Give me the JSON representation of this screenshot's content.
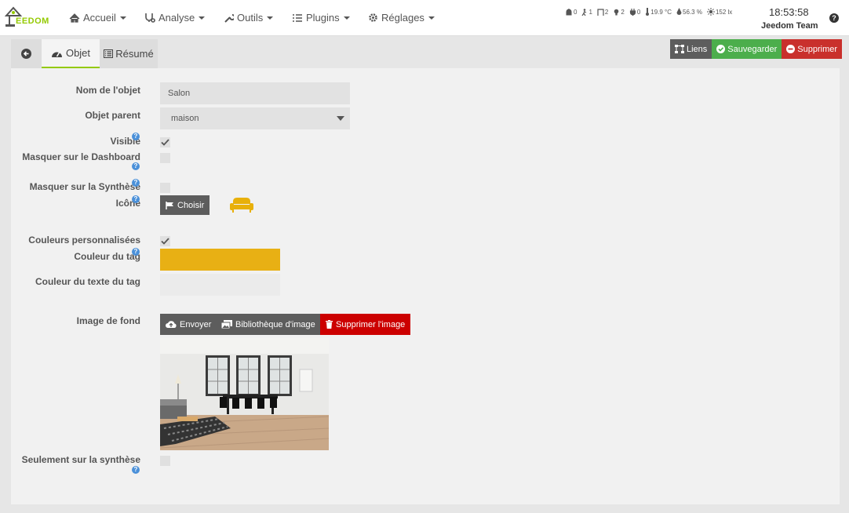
{
  "header": {
    "logo_text": "EEDOM",
    "menu": [
      {
        "label": "Accueil",
        "icon": "home-icon"
      },
      {
        "label": "Analyse",
        "icon": "stethoscope-icon"
      },
      {
        "label": "Outils",
        "icon": "wrench-icon"
      },
      {
        "label": "Plugins",
        "icon": "list-icon"
      },
      {
        "label": "Réglages",
        "icon": "gear-icon"
      }
    ],
    "status": {
      "alarm": "0",
      "motion": "1",
      "door": "2",
      "light": "2",
      "plug": "0",
      "temperature": "19.9 °C",
      "humidity": "56.3 %",
      "luminosity": "152 lx"
    },
    "time": "18:53:58",
    "user": "Jeedom Team",
    "help": "?"
  },
  "tabs": {
    "object": "Objet",
    "summary": "Résumé"
  },
  "actions": {
    "links": "Liens",
    "save": "Sauvegarder",
    "delete": "Supprimer"
  },
  "form": {
    "name_label": "Nom de l'objet",
    "name_value": "Salon",
    "parent_label": "Objet parent",
    "parent_value": "maison",
    "visible_label": "Visible",
    "visible_checked": true,
    "hide_dashboard_label": "Masquer sur le Dashboard",
    "hide_dashboard_checked": false,
    "hide_synthesis_label": "Masquer sur la Synthèse",
    "hide_synthesis_checked": false,
    "icon_label": "Icône",
    "choose_label": "Choisir",
    "icon_preview": "sofa-icon",
    "icon_color": "#e8b00a",
    "custom_colors_label": "Couleurs personnalisées",
    "custom_colors_checked": true,
    "tag_color_label": "Couleur du tag",
    "tag_color": "#e8b014",
    "tag_text_color_label": "Couleur du texte du tag",
    "tag_text_color": "#ebebeb",
    "background_label": "Image de fond",
    "upload_label": "Envoyer",
    "library_label": "Bibliothèque d'image",
    "remove_image_label": "Supprimer l'image",
    "synthesis_only_label": "Seulement sur la synthèse",
    "synthesis_only_checked": false
  },
  "colors": {
    "accent": "#94ca02",
    "success": "#4cae4c",
    "danger": "#c9302c",
    "default": "#5d5d5d"
  }
}
